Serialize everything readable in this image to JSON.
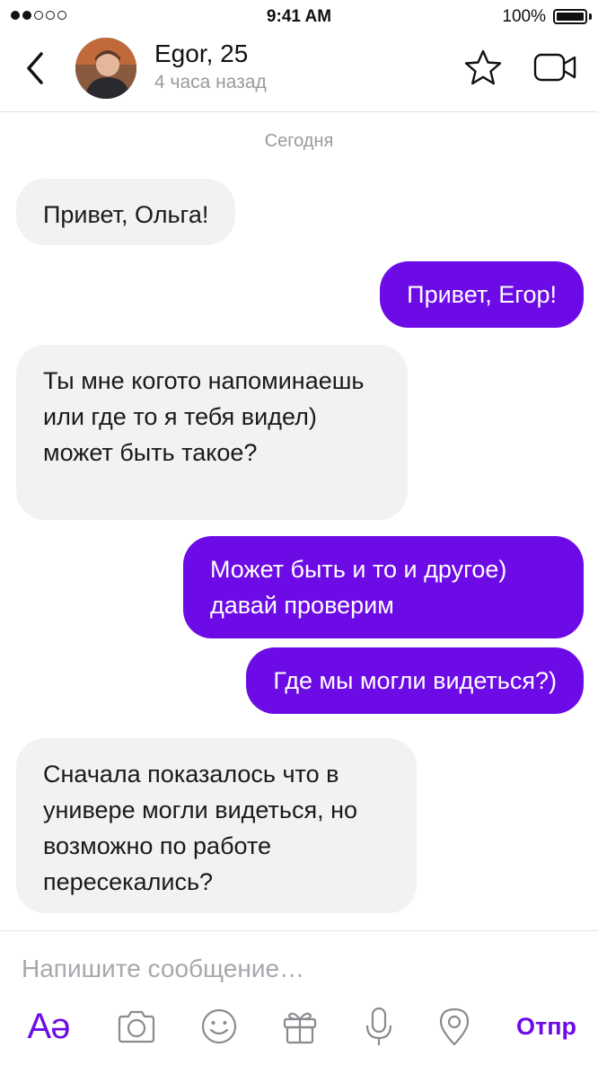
{
  "status_bar": {
    "time": "9:41 AM",
    "battery": "100%",
    "signal_filled": 2,
    "signal_total": 5,
    "battery_level": 1.0
  },
  "header": {
    "back_icon": "chevron-left-icon",
    "name": "Egor, 25",
    "last_seen": "4 часа назад",
    "favorite_icon": "star-icon",
    "video_icon": "video-camera-icon"
  },
  "chat": {
    "day_separator": "Сегодня",
    "messages": [
      {
        "direction": "incoming",
        "text": "Привет, Ольга!"
      },
      {
        "direction": "outgoing",
        "text": "Привет, Егор!"
      },
      {
        "direction": "incoming",
        "text": "Ты мне когото напоминаешь или где то я тебя видел) может быть такое?"
      },
      {
        "direction": "outgoing",
        "text": "Может быть и то и другое) давай проверим"
      },
      {
        "direction": "outgoing",
        "text": "Где мы могли видеться?)"
      },
      {
        "direction": "incoming",
        "text": "Сначала показалось что в универе могли видеться, но возможно по работе пересекались?"
      }
    ]
  },
  "composer": {
    "placeholder": "Напишите сообщение…",
    "value": "",
    "format_label": "Aə",
    "send_label": "Отпр",
    "tools": [
      "camera-icon",
      "emoji-icon",
      "gift-icon",
      "microphone-icon",
      "location-icon"
    ]
  },
  "colors": {
    "accent": "#6d0be6",
    "incoming_bubble": "#f2f2f4",
    "muted_text": "#9a9aa0"
  }
}
